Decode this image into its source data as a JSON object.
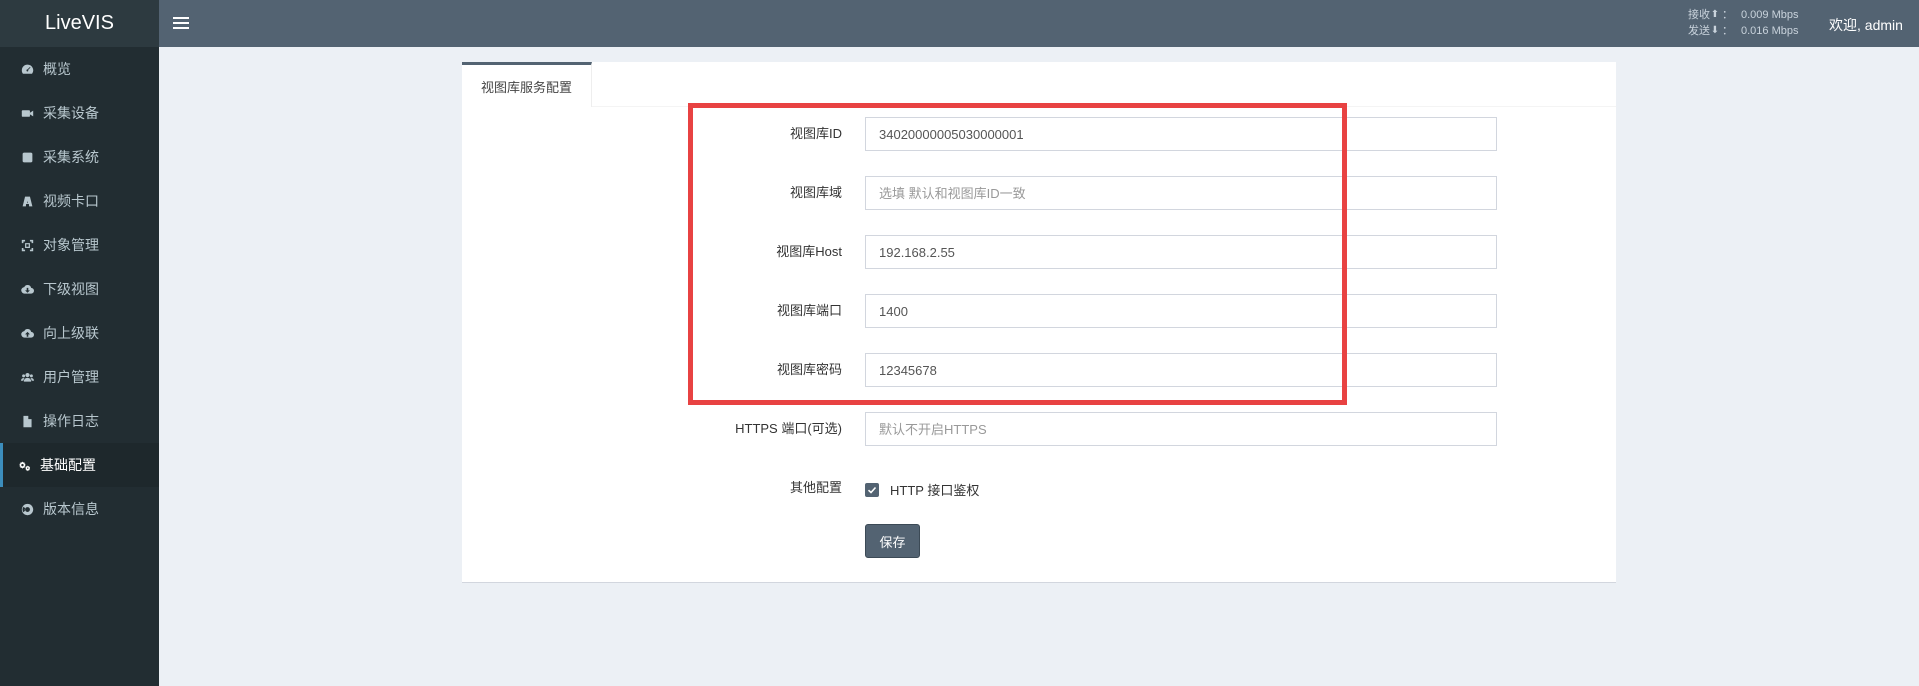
{
  "app": {
    "logo": "LiveVIS"
  },
  "sidebar": {
    "items": [
      {
        "label": "概览",
        "icon": "dashboard-icon"
      },
      {
        "label": "采集设备",
        "icon": "camera-icon"
      },
      {
        "label": "采集系统",
        "icon": "square-icon"
      },
      {
        "label": "视频卡口",
        "icon": "road-icon"
      },
      {
        "label": "对象管理",
        "icon": "object-icon"
      },
      {
        "label": "下级视图",
        "icon": "cloud-download-icon"
      },
      {
        "label": "向上级联",
        "icon": "cloud-upload-icon"
      },
      {
        "label": "用户管理",
        "icon": "users-icon"
      },
      {
        "label": "操作日志",
        "icon": "file-icon"
      },
      {
        "label": "基础配置",
        "icon": "gears-icon",
        "active": true
      },
      {
        "label": "版本信息",
        "icon": "lifebuoy-icon"
      }
    ]
  },
  "topbar": {
    "recv_label": "接收",
    "recv_value": "0.009 Mbps",
    "send_label": "发送",
    "send_value": "0.016 Mbps",
    "separator": "：",
    "welcome": "欢迎, admin"
  },
  "panel": {
    "tab": "视图库服务配置",
    "fields": {
      "id": {
        "label": "视图库ID",
        "value": "34020000005030000001",
        "placeholder": ""
      },
      "domain": {
        "label": "视图库域",
        "value": "",
        "placeholder": "选填 默认和视图库ID一致"
      },
      "host": {
        "label": "视图库Host",
        "value": "192.168.2.55",
        "placeholder": ""
      },
      "port": {
        "label": "视图库端口",
        "value": "1400",
        "placeholder": ""
      },
      "password": {
        "label": "视图库密码",
        "value": "12345678",
        "placeholder": ""
      },
      "https_port": {
        "label": "HTTPS 端口(可选)",
        "value": "",
        "placeholder": "默认不开启HTTPS"
      }
    },
    "other": {
      "label": "其他配置",
      "checkbox_label": "HTTP 接口鉴权",
      "checked": true
    },
    "save_label": "保存"
  },
  "colors": {
    "accent": "#536372",
    "highlight": "#e84242",
    "sidebar": "#222d32"
  }
}
